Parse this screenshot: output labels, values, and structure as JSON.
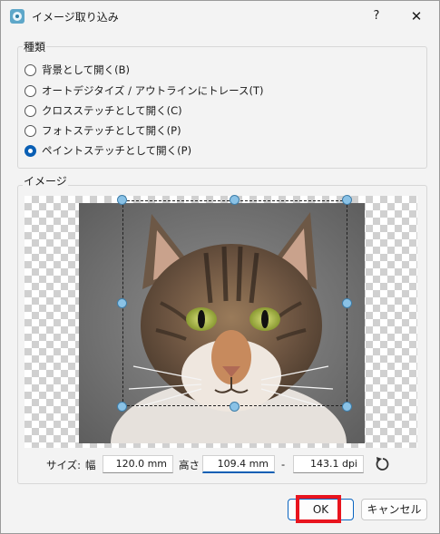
{
  "window": {
    "title": "イメージ取り込み",
    "help_label": "?",
    "close_label": "✕"
  },
  "type_group": {
    "legend": "種類",
    "options": [
      {
        "label": "背景として開く(B)",
        "selected": false
      },
      {
        "label": "オートデジタイズ / アウトラインにトレース(T)",
        "selected": false
      },
      {
        "label": "クロスステッチとして開く(C)",
        "selected": false
      },
      {
        "label": "フォトステッチとして開く(P)",
        "selected": false
      },
      {
        "label": "ペイントステッチとして開く(P)",
        "selected": true
      }
    ]
  },
  "image_group": {
    "legend": "イメージ"
  },
  "size": {
    "label": "サイズ:",
    "width_label": "幅",
    "width_value": "120.0 mm",
    "height_label": "高さ",
    "height_value": "109.4 mm",
    "separator": "-",
    "dpi_value": "143.1 dpi"
  },
  "buttons": {
    "ok": "OK",
    "cancel": "キャンセル"
  },
  "colors": {
    "accent": "#0a5fb4",
    "highlight": "#e8141e",
    "handle": "#8ac2e6"
  }
}
